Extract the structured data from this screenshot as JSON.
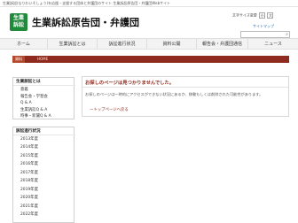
{
  "topbar": {
    "text": "生業訴訟(なりわいそしょう)を応援・支援する団体と弁護団のサイト 生業訴訟原告団・弁護団Webサイト"
  },
  "header": {
    "logo_line1": "生業",
    "logo_line2": "訴訟",
    "title": "生業訴訟原告団・弁護団",
    "font_size_label": "文字サイズ変更",
    "font_size_small": "小",
    "font_size_large": "大",
    "sitemap": "サイトマップ"
  },
  "nav": {
    "items": [
      "ホーム",
      "生業訴訟とは",
      "訴訟進行状況",
      "資料公開",
      "報告会・弁護団通信",
      "ニュース"
    ]
  },
  "breadcrumb": {
    "head": "資料",
    "home": "HOME"
  },
  "sidebar": {
    "group1": {
      "title": "生業訴訟とは",
      "links": [
        "意義",
        "報告会・学習会",
        "Q & A",
        "生業訴訟Q & A",
        "時事・新聞Q & A"
      ]
    },
    "group2": {
      "title": "訴訟進行状況",
      "links": [
        "2013年度",
        "2014年度",
        "2015年度",
        "2016年度",
        "2017年度",
        "2018年度",
        "2019年度",
        "2020年度",
        "2021年度",
        "2022年度"
      ]
    }
  },
  "main": {
    "title": "お探しのページは見つかりませんでした。",
    "message": "お探しのページは一時的にアクセスができない状況にあるか、移動もしくは削除された可能性があります。",
    "link": "ートップページへ戻る"
  }
}
